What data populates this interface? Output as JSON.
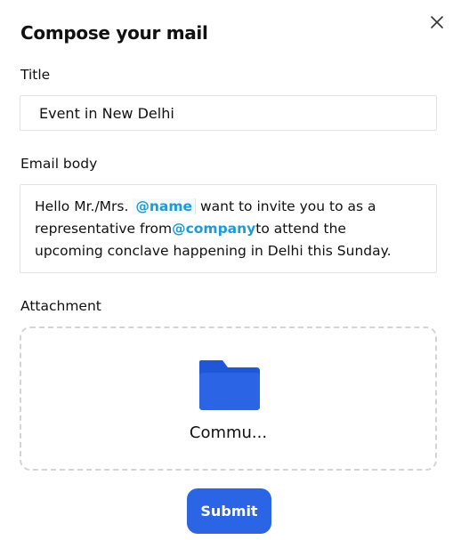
{
  "modal": {
    "title": "Compose your mail",
    "close_icon": "close-icon"
  },
  "title_field": {
    "label": "Title",
    "value": "Event in New Delhi"
  },
  "email_body": {
    "label": "Email body",
    "line1_before": "Hello Mr./Mrs. ",
    "name_token": "@name",
    "line1_after": " want to invite you to as a",
    "line2_before": "representative from",
    "company_token": "@company",
    "line2_after": "to attend the",
    "line3": "upcoming conclave happening in Delhi this Sunday."
  },
  "attachment": {
    "label": "Attachment",
    "icon": "folder-icon",
    "file_name": "Commu..."
  },
  "submit_label": "Submit",
  "colors": {
    "accent": "#2c64e6",
    "token": "#1a9bdb",
    "folder": "#2c64e6"
  }
}
